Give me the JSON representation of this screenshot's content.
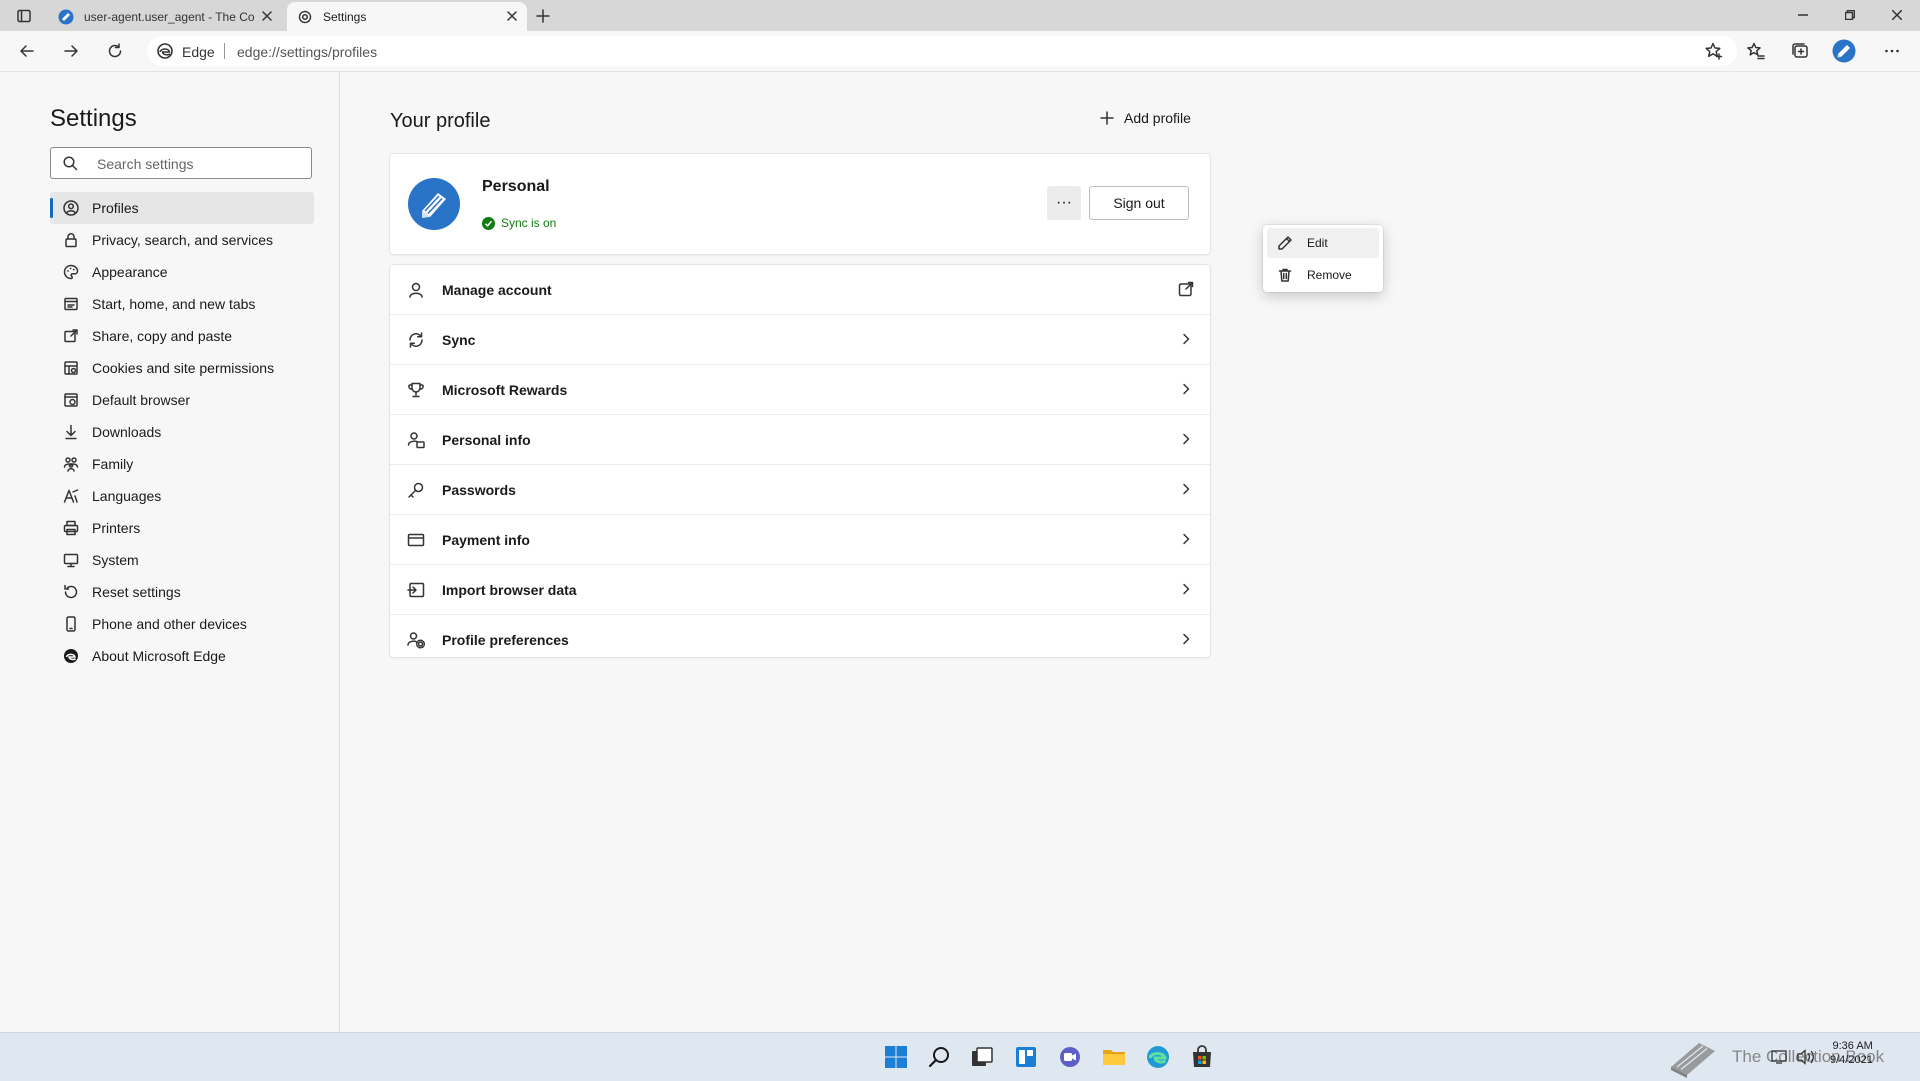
{
  "browser": {
    "tabs": [
      {
        "title": "user-agent.user_agent - The Coll",
        "active": false
      },
      {
        "title": "Settings",
        "active": true
      }
    ],
    "address": {
      "scheme_label": "Edge",
      "url": "edge://settings/profiles"
    }
  },
  "sidebar": {
    "title": "Settings",
    "search_placeholder": "Search settings",
    "items": [
      {
        "label": "Profiles",
        "icon": "profile-icon",
        "active": true
      },
      {
        "label": "Privacy, search, and services",
        "icon": "lock-icon"
      },
      {
        "label": "Appearance",
        "icon": "palette-icon"
      },
      {
        "label": "Start, home, and new tabs",
        "icon": "home-tab-icon"
      },
      {
        "label": "Share, copy and paste",
        "icon": "share-icon"
      },
      {
        "label": "Cookies and site permissions",
        "icon": "cookie-icon"
      },
      {
        "label": "Default browser",
        "icon": "browser-icon"
      },
      {
        "label": "Downloads",
        "icon": "download-icon"
      },
      {
        "label": "Family",
        "icon": "family-icon"
      },
      {
        "label": "Languages",
        "icon": "language-icon"
      },
      {
        "label": "Printers",
        "icon": "printer-icon"
      },
      {
        "label": "System",
        "icon": "system-icon"
      },
      {
        "label": "Reset settings",
        "icon": "reset-icon"
      },
      {
        "label": "Phone and other devices",
        "icon": "phone-icon"
      },
      {
        "label": "About Microsoft Edge",
        "icon": "edge-icon"
      }
    ]
  },
  "profile": {
    "section_title": "Your profile",
    "add_profile_label": "Add profile",
    "name": "Personal",
    "sync_status": "Sync is on",
    "more_label": "···",
    "sign_out_label": "Sign out",
    "menu": {
      "edit_label": "Edit",
      "remove_label": "Remove"
    }
  },
  "settings_rows": [
    {
      "label": "Manage account",
      "icon": "person-icon",
      "trailing": "external-link-icon"
    },
    {
      "label": "Sync",
      "icon": "sync-icon",
      "trailing": "chevron-right-icon"
    },
    {
      "label": "Microsoft Rewards",
      "icon": "trophy-icon",
      "trailing": "chevron-right-icon"
    },
    {
      "label": "Personal info",
      "icon": "personal-info-icon",
      "trailing": "chevron-right-icon"
    },
    {
      "label": "Passwords",
      "icon": "key-icon",
      "trailing": "chevron-right-icon"
    },
    {
      "label": "Payment info",
      "icon": "card-icon",
      "trailing": "chevron-right-icon"
    },
    {
      "label": "Import browser data",
      "icon": "import-icon",
      "trailing": "chevron-right-icon"
    },
    {
      "label": "Profile preferences",
      "icon": "profile-settings-icon",
      "trailing": "chevron-right-icon"
    }
  ],
  "taskbar": {
    "apps": [
      "start-icon",
      "search-icon",
      "task-view-icon",
      "widgets-icon",
      "teams-chat-icon",
      "file-explorer-icon",
      "edge-icon",
      "store-icon"
    ],
    "watermark": "The Collection Book",
    "clock_time": "9:36 AM",
    "clock_date": "9/4/2021"
  },
  "colors": {
    "accent": "#0f6cbd",
    "sync_green": "#107c10",
    "avatar_blue": "#2a74c7"
  }
}
